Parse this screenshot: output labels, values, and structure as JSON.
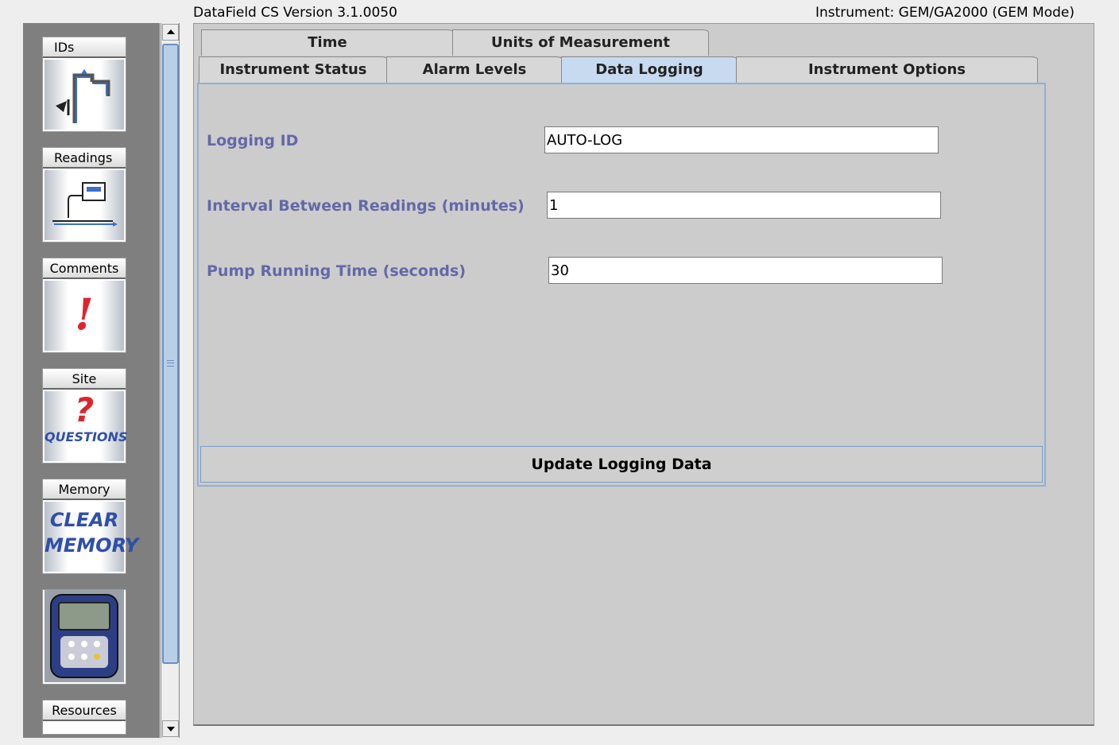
{
  "header": {
    "version": "DataField CS Version 3.1.0050",
    "instrument": "Instrument: GEM/GA2000 (GEM Mode)"
  },
  "sidebar": {
    "items": [
      {
        "label": "IDs",
        "icon": "pipe-id-icon",
        "checked": true
      },
      {
        "label": "Readings",
        "icon": "readings-monitor-icon",
        "checked": true
      },
      {
        "label": "Comments",
        "icon": "exclamation-icon",
        "checked": false
      },
      {
        "label": "Site",
        "icon": "questions-icon",
        "checked": false,
        "art_text": "QUESTIONS"
      },
      {
        "label": "Memory",
        "icon": "clear-memory-icon",
        "checked": false,
        "art_text_1": "CLEAR",
        "art_text_2": "MEMORY"
      },
      {
        "label": "",
        "icon": "instrument-device-icon",
        "checked": false
      },
      {
        "label": "Resources",
        "icon": "resources-icon",
        "checked": false
      }
    ],
    "check_mark": "✓",
    "exclamation": "!",
    "question": "?"
  },
  "tabs": {
    "row1": [
      {
        "label": "Time"
      },
      {
        "label": "Units of Measurement"
      }
    ],
    "row2": [
      {
        "label": "Instrument Status"
      },
      {
        "label": "Alarm Levels"
      },
      {
        "label": "Data Logging",
        "selected": true
      },
      {
        "label": "Instrument Options"
      }
    ]
  },
  "form": {
    "logging_id_label": "Logging ID",
    "logging_id_value": "AUTO-LOG",
    "interval_label": "Interval Between Readings (minutes)",
    "interval_value": "1",
    "pump_label": "Pump Running Time (seconds)",
    "pump_value": "30",
    "update_button": "Update Logging Data"
  },
  "colors": {
    "label": "#6468a8",
    "selected_tab": "#c7daf0",
    "sidebar_bg": "#7f7f7f",
    "panel_bg": "#cccccc"
  }
}
